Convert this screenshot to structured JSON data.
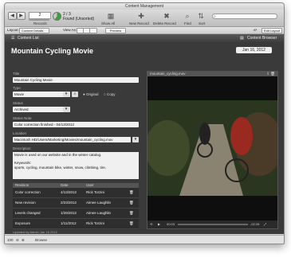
{
  "window": {
    "title": "Content Management"
  },
  "toolbar": {
    "record_number": "2",
    "found_total": "2 / 3",
    "found_label": "Found (Unsorted)",
    "records_label": "Records",
    "show_all": "Show All",
    "new_record": "New Record",
    "delete_record": "Delete Record",
    "find": "Find",
    "sort": "Sort"
  },
  "layoutbar": {
    "layout_label": "Layout:",
    "layout_value": "Content Details",
    "view_as_label": "View As:",
    "preview": "Preview",
    "edit_layout": "Edit Layout",
    "aa": "Aª"
  },
  "header": {
    "content_list": "Content List",
    "content_browser": "Content Browser"
  },
  "record": {
    "title": "Mountain Cycling Movie",
    "date": "Jan 16, 2012",
    "title_label": "Title",
    "title_value": "Mountain Cycling Movie",
    "type_label": "Type",
    "type_value": "Movie",
    "radio_original": "Original",
    "radio_copy": "Copy",
    "status_label": "Status",
    "status_value": "Archived",
    "status_note_label": "Status Note",
    "status_note_value": "Color correction finished - 04/13/2012",
    "location_label": "Location",
    "location_value": "Macintosh HD/Users/Marketing/Movies/mountain_cycling.mov",
    "description_label": "Description",
    "description_line1": "Movie is used on our website and  in the winter catalog.",
    "keywords_label": "Keywords:",
    "keywords_value": "sports, cycling, mountain bike, winter, snow, climbing, tire,"
  },
  "revisions": {
    "headers": [
      "Revision",
      "Date",
      "User"
    ],
    "rows": [
      [
        "Color correction",
        "4/13/2012",
        "Rick Torzini"
      ],
      [
        "New revision",
        "2/23/2012",
        "Aimee Laughlin"
      ],
      [
        "Levels changed",
        "1/26/2012",
        "Aimee Laughlin"
      ],
      [
        "Exposure",
        "1/11/2012",
        "Rick Torzini"
      ]
    ]
  },
  "updated": "Updated by Admin Jan 16 2012",
  "video": {
    "filename": "mountain_cycling.mov",
    "time_start": "00:03",
    "time_end": "-02:26"
  },
  "statusbar": {
    "zoom": "100",
    "mode": "Browse"
  }
}
